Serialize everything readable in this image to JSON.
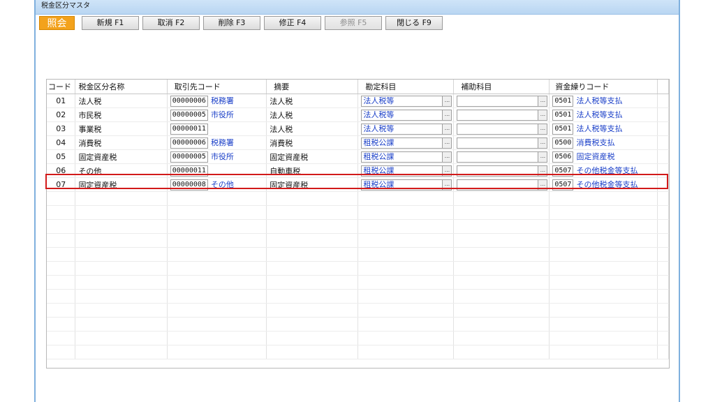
{
  "window": {
    "title": "税金区分マスタ"
  },
  "toolbar": {
    "mode_label": "照会",
    "buttons": [
      {
        "label": "新規 F1",
        "enabled": true
      },
      {
        "label": "取消 F2",
        "enabled": true
      },
      {
        "label": "削除 F3",
        "enabled": true
      },
      {
        "label": "修正 F4",
        "enabled": true
      },
      {
        "label": "参照 F5",
        "enabled": false
      },
      {
        "label": "閉じる F9",
        "enabled": true
      }
    ]
  },
  "grid": {
    "headers": [
      "コード",
      "税金区分名称",
      "取引先コード",
      "摘要",
      "勘定科目",
      "補助科目",
      "資金繰りコード"
    ],
    "rows": [
      {
        "code": "01",
        "name": "法人税",
        "partner_code": "00000006",
        "partner_name": "税務署",
        "summary": "法人税",
        "account": "法人税等",
        "sub_account": "",
        "cash_code": "0501",
        "cash_name": "法人税等支払"
      },
      {
        "code": "02",
        "name": "市民税",
        "partner_code": "00000005",
        "partner_name": "市役所",
        "summary": "法人税",
        "account": "法人税等",
        "sub_account": "",
        "cash_code": "0501",
        "cash_name": "法人税等支払"
      },
      {
        "code": "03",
        "name": "事業税",
        "partner_code": "00000011",
        "partner_name": "",
        "summary": "法人税",
        "account": "法人税等",
        "sub_account": "",
        "cash_code": "0501",
        "cash_name": "法人税等支払"
      },
      {
        "code": "04",
        "name": "消費税",
        "partner_code": "00000006",
        "partner_name": "税務署",
        "summary": "消費税",
        "account": "租税公課",
        "sub_account": "",
        "cash_code": "0500",
        "cash_name": "消費税支払"
      },
      {
        "code": "05",
        "name": "固定資産税",
        "partner_code": "00000005",
        "partner_name": "市役所",
        "summary": "固定資産税",
        "account": "租税公課",
        "sub_account": "",
        "cash_code": "0506",
        "cash_name": "固定資産税"
      },
      {
        "code": "06",
        "name": "その他",
        "partner_code": "00000011",
        "partner_name": "",
        "summary": "自動車税",
        "account": "租税公課",
        "sub_account": "",
        "cash_code": "0507",
        "cash_name": "その他税金等支払"
      },
      {
        "code": "07",
        "name": "固定資産税",
        "partner_code": "00000008",
        "partner_name": "その他",
        "summary": "固定資産税",
        "account": "租税公課",
        "sub_account": "",
        "cash_code": "0507",
        "cash_name": "その他税金等支払"
      }
    ],
    "ellipsis_label": "...",
    "highlighted_row": 6,
    "highlight_color": "#d21a1a"
  }
}
